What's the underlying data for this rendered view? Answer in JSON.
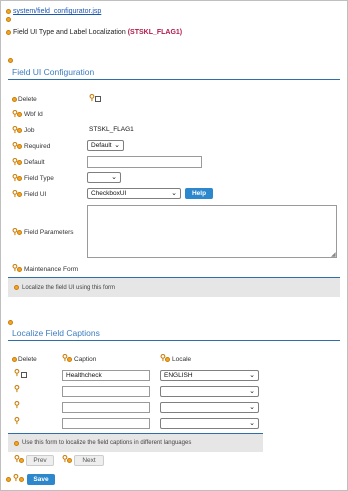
{
  "header": {
    "path_link": "system/field_configurator.jsp",
    "title_prefix": "Field UI Type and Label Localization",
    "title_id": "(STSKL_FLAG1)"
  },
  "field_ui_config": {
    "section_title": "Field UI Configuration",
    "labels": {
      "delete": "Delete",
      "wbf_id": "Wbf Id",
      "job": "Job",
      "required": "Required",
      "default": "Default",
      "field_type": "Field Type",
      "field_ui": "Field UI",
      "field_parameters": "Field Parameters",
      "maintenance_form": "Maintenance Form"
    },
    "values": {
      "job": "STSKL_FLAG1",
      "required": "Default",
      "default": "",
      "field_type": "",
      "field_ui": "CheckboxUI",
      "field_parameters": ""
    },
    "help_button": "Help",
    "info_text": "Localize the field UI using this form"
  },
  "captions": {
    "section_title": "Localize Field Captions",
    "headers": {
      "delete": "Delete",
      "caption": "Caption",
      "locale": "Locale"
    },
    "rows": [
      {
        "caption": "Healthcheck",
        "locale": "ENGLISH",
        "has_checkbox": true
      },
      {
        "caption": "",
        "locale": "",
        "has_checkbox": false
      },
      {
        "caption": "",
        "locale": "",
        "has_checkbox": false
      },
      {
        "caption": "",
        "locale": "",
        "has_checkbox": false
      }
    ],
    "info_text": "Use this form to localize the field captions in different languages",
    "prev_label": "Prev",
    "next_label": "Next"
  },
  "footer": {
    "save_label": "Save"
  },
  "colors": {
    "accent": "#2d87cc",
    "section_title": "#3c7dbf",
    "id_red": "#b01a4a",
    "icon_orange": "#f5a623"
  }
}
